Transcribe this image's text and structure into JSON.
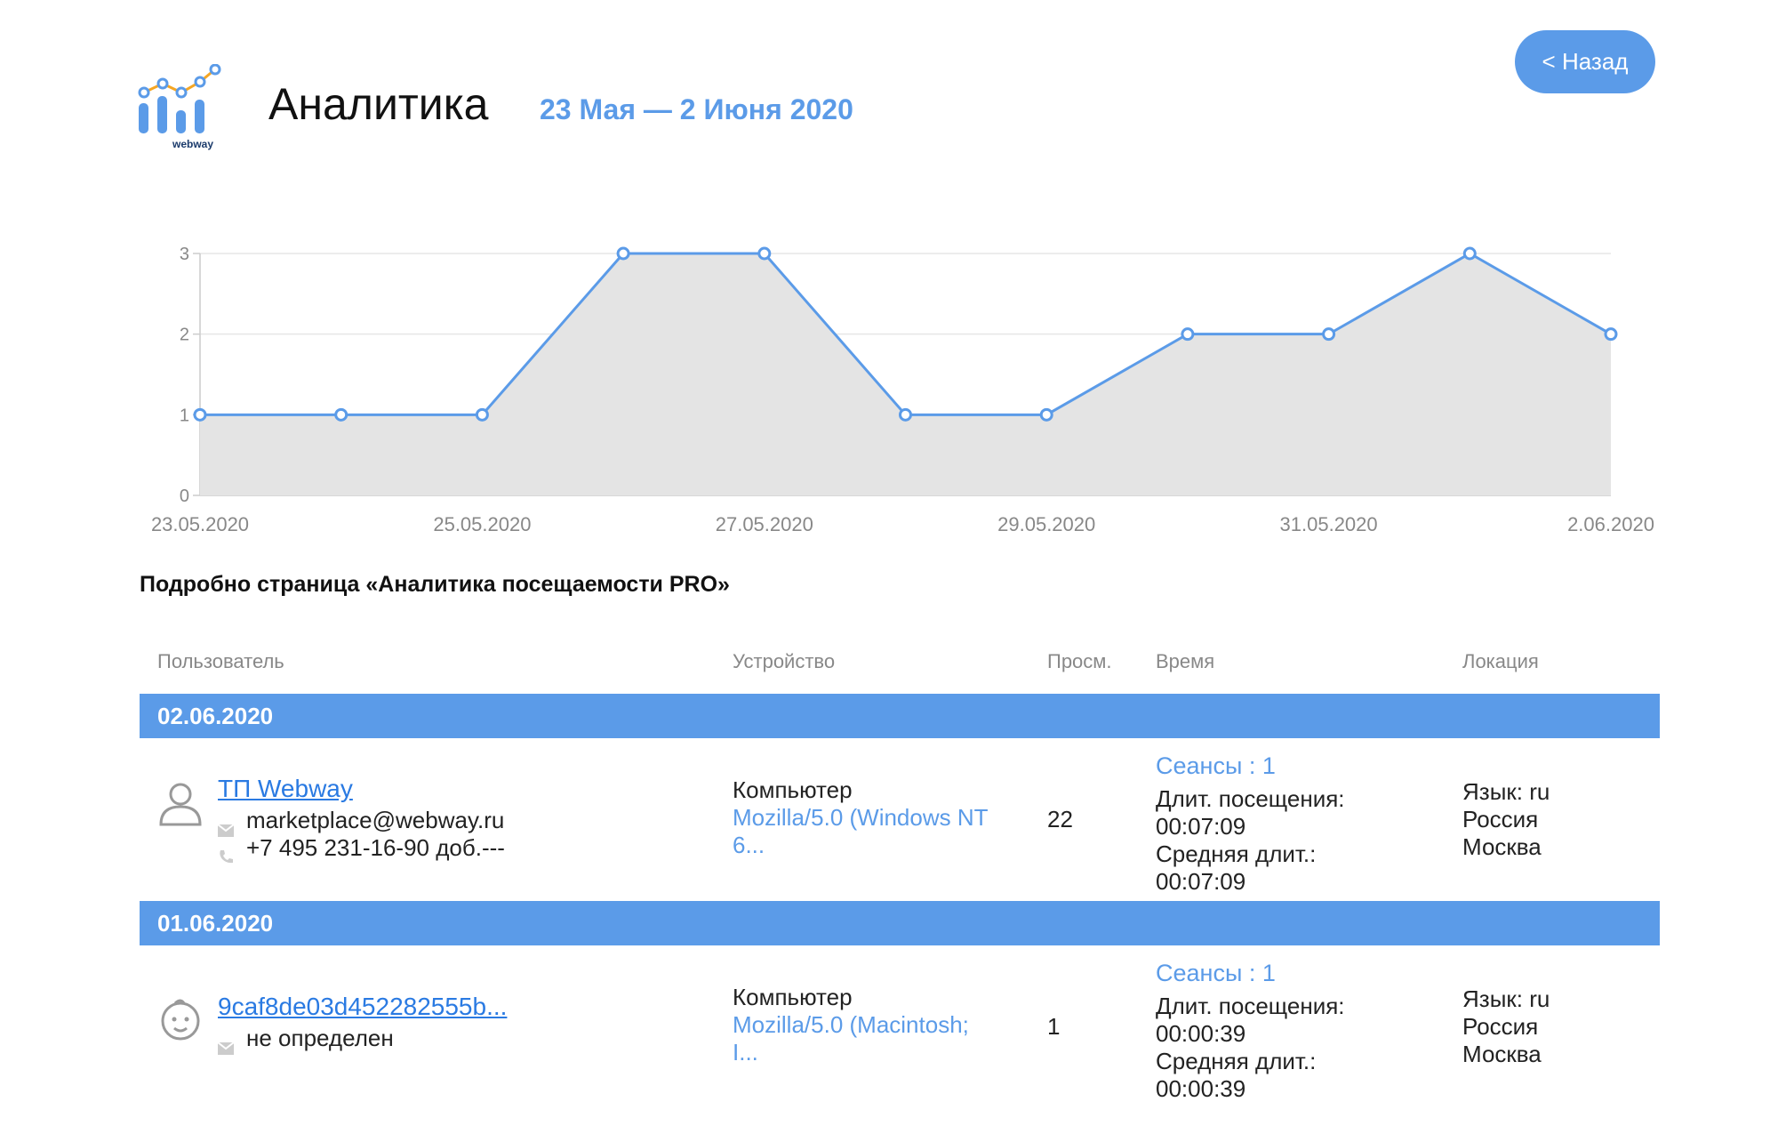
{
  "header": {
    "title": "Аналитика",
    "date_range": "23 Мая — 2 Июня 2020",
    "back_label": "< Назад",
    "logo_text": "webway"
  },
  "colors": {
    "accent": "#5b9be8",
    "link": "#2a7ae2",
    "area_fill": "#e4e4e4"
  },
  "chart_data": {
    "type": "area",
    "x": [
      "23.05.2020",
      "24.05.2020",
      "25.05.2020",
      "26.05.2020",
      "27.05.2020",
      "28.05.2020",
      "29.05.2020",
      "30.05.2020",
      "31.05.2020",
      "1.06.2020",
      "2.06.2020"
    ],
    "values": [
      1,
      1,
      1,
      3,
      3,
      1,
      1,
      2,
      2,
      3,
      2
    ],
    "x_tick_labels": [
      "23.05.2020",
      "25.05.2020",
      "27.05.2020",
      "29.05.2020",
      "31.05.2020",
      "2.06.2020"
    ],
    "y_ticks": [
      "0",
      "1",
      "2",
      "3"
    ],
    "ylim": [
      0,
      3
    ],
    "grid": true
  },
  "section": {
    "title": "Подробно страница «Аналитика посещаемости PRO»"
  },
  "table": {
    "columns": [
      "Пользователь",
      "Устройство",
      "Просм.",
      "Время",
      "Локация"
    ],
    "groups": [
      {
        "date": "02.06.2020",
        "user": {
          "icon": "person-icon",
          "name": "ТП Webway",
          "email": "marketplace@webway.ru",
          "phone": "+7 495 231-16-90 доб.---"
        },
        "device": {
          "type": "Компьютер",
          "ua_line1": "Mozilla/5.0 (Windows NT",
          "ua_line2": "6..."
        },
        "views": "22",
        "time": {
          "sessions": "Сеансы : 1",
          "visit_label": "Длит. посещения:",
          "visit_value": "00:07:09",
          "avg_label": "Средняя длит.:",
          "avg_value": "00:07:09"
        },
        "location": {
          "language": "Язык: ru",
          "country": "Россия",
          "city": "Москва"
        }
      },
      {
        "date": "01.06.2020",
        "user": {
          "icon": "baby-face-icon",
          "name": "9caf8de03d452282555b...",
          "email": "не определен"
        },
        "device": {
          "type": "Компьютер",
          "ua_line1": "Mozilla/5.0 (Macintosh;",
          "ua_line2": "I..."
        },
        "views": "1",
        "time": {
          "sessions": "Сеансы : 1",
          "visit_label": "Длит. посещения:",
          "visit_value": "00:00:39",
          "avg_label": "Средняя длит.:",
          "avg_value": "00:00:39"
        },
        "location": {
          "language": "Язык: ru",
          "country": "Россия",
          "city": "Москва"
        }
      }
    ]
  }
}
